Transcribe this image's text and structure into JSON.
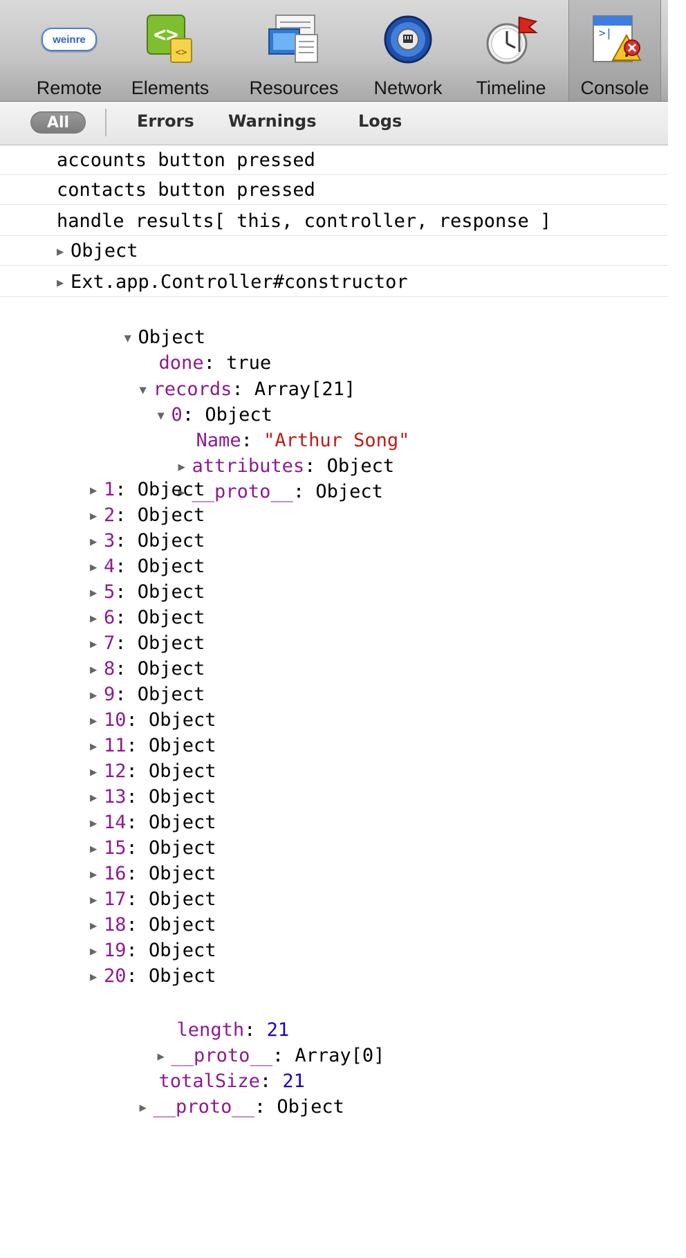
{
  "toolbar": {
    "tools": [
      {
        "label": "Remote",
        "icon": "weinre-icon",
        "badge": "weinre"
      },
      {
        "label": "Elements",
        "icon": "elements-icon"
      },
      {
        "label": "Resources",
        "icon": "resources-icon"
      },
      {
        "label": "Network",
        "icon": "network-icon"
      },
      {
        "label": "Timeline",
        "icon": "timeline-icon"
      },
      {
        "label": "Console",
        "icon": "console-icon",
        "active": true
      }
    ]
  },
  "filters": {
    "all": "All",
    "errors": "Errors",
    "warnings": "Warnings",
    "logs": "Logs"
  },
  "console": {
    "messages": [
      "accounts button pressed",
      "contacts button pressed",
      "handle results[ this, controller, response ]"
    ],
    "collapsed": [
      "Object",
      "Ext.app.Controller#constructor"
    ],
    "root": {
      "label": "Object",
      "done": {
        "key": "done",
        "value": "true"
      },
      "records": {
        "key": "records",
        "value": "Array[21]",
        "item0": {
          "key": "0",
          "value": "Object",
          "name": {
            "key": "Name",
            "value": "\"Arthur Song\""
          },
          "attributes": {
            "key": "attributes",
            "value": "Object"
          },
          "proto": {
            "key": "__proto__",
            "value": "Object"
          }
        },
        "items": [
          {
            "key": "1",
            "value": "Object"
          },
          {
            "key": "2",
            "value": "Object"
          },
          {
            "key": "3",
            "value": "Object"
          },
          {
            "key": "4",
            "value": "Object"
          },
          {
            "key": "5",
            "value": "Object"
          },
          {
            "key": "6",
            "value": "Object"
          },
          {
            "key": "7",
            "value": "Object"
          },
          {
            "key": "8",
            "value": "Object"
          },
          {
            "key": "9",
            "value": "Object"
          },
          {
            "key": "10",
            "value": "Object"
          },
          {
            "key": "11",
            "value": "Object"
          },
          {
            "key": "12",
            "value": "Object"
          },
          {
            "key": "13",
            "value": "Object"
          },
          {
            "key": "14",
            "value": "Object"
          },
          {
            "key": "15",
            "value": "Object"
          },
          {
            "key": "16",
            "value": "Object"
          },
          {
            "key": "17",
            "value": "Object"
          },
          {
            "key": "18",
            "value": "Object"
          },
          {
            "key": "19",
            "value": "Object"
          },
          {
            "key": "20",
            "value": "Object"
          }
        ],
        "length": {
          "key": "length",
          "value": "21"
        },
        "proto": {
          "key": "__proto__",
          "value": "Array[0]"
        }
      },
      "totalSize": {
        "key": "totalSize",
        "value": "21"
      },
      "proto": {
        "key": "__proto__",
        "value": "Object"
      }
    }
  },
  "colors": {
    "key": "#8e1a8f",
    "string": "#c41a16",
    "number": "#1c00cf"
  }
}
